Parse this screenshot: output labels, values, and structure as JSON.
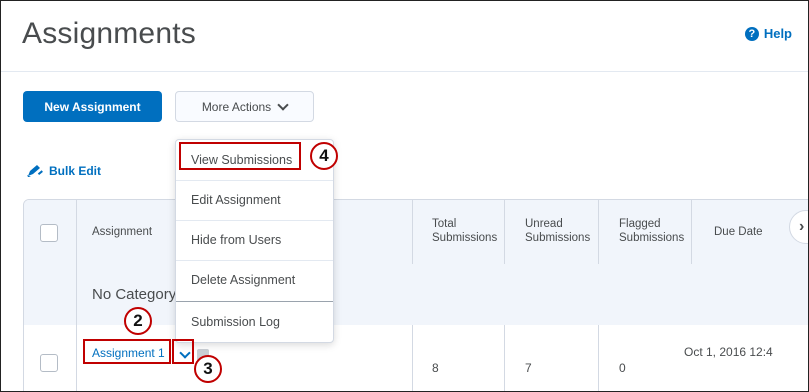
{
  "page": {
    "title": "Assignments",
    "help_label": "Help"
  },
  "toolbar": {
    "new_assignment": "New Assignment",
    "more_actions": "More Actions"
  },
  "bulk_edit": "Bulk Edit",
  "table": {
    "headers": {
      "assignment": "Assignment",
      "total": [
        "Total",
        "Submissions"
      ],
      "unread": [
        "Unread",
        "Submissions"
      ],
      "flagged": [
        "Flagged",
        "Submissions"
      ],
      "due": "Due Date"
    },
    "category": "No Category",
    "rows": [
      {
        "name": "Assignment 1",
        "total": "8",
        "unread": "7",
        "flagged": "0",
        "due": "Oct 1, 2016 12:4"
      }
    ]
  },
  "dropdown": {
    "items": [
      "View Submissions",
      "Edit Assignment",
      "Hide from Users",
      "Delete Assignment",
      "Submission Log"
    ]
  },
  "callouts": [
    "2",
    "3",
    "4"
  ],
  "colors": {
    "accent": "#006fbf",
    "callout": "#c00000",
    "header_bg": "#f1f5fb"
  }
}
